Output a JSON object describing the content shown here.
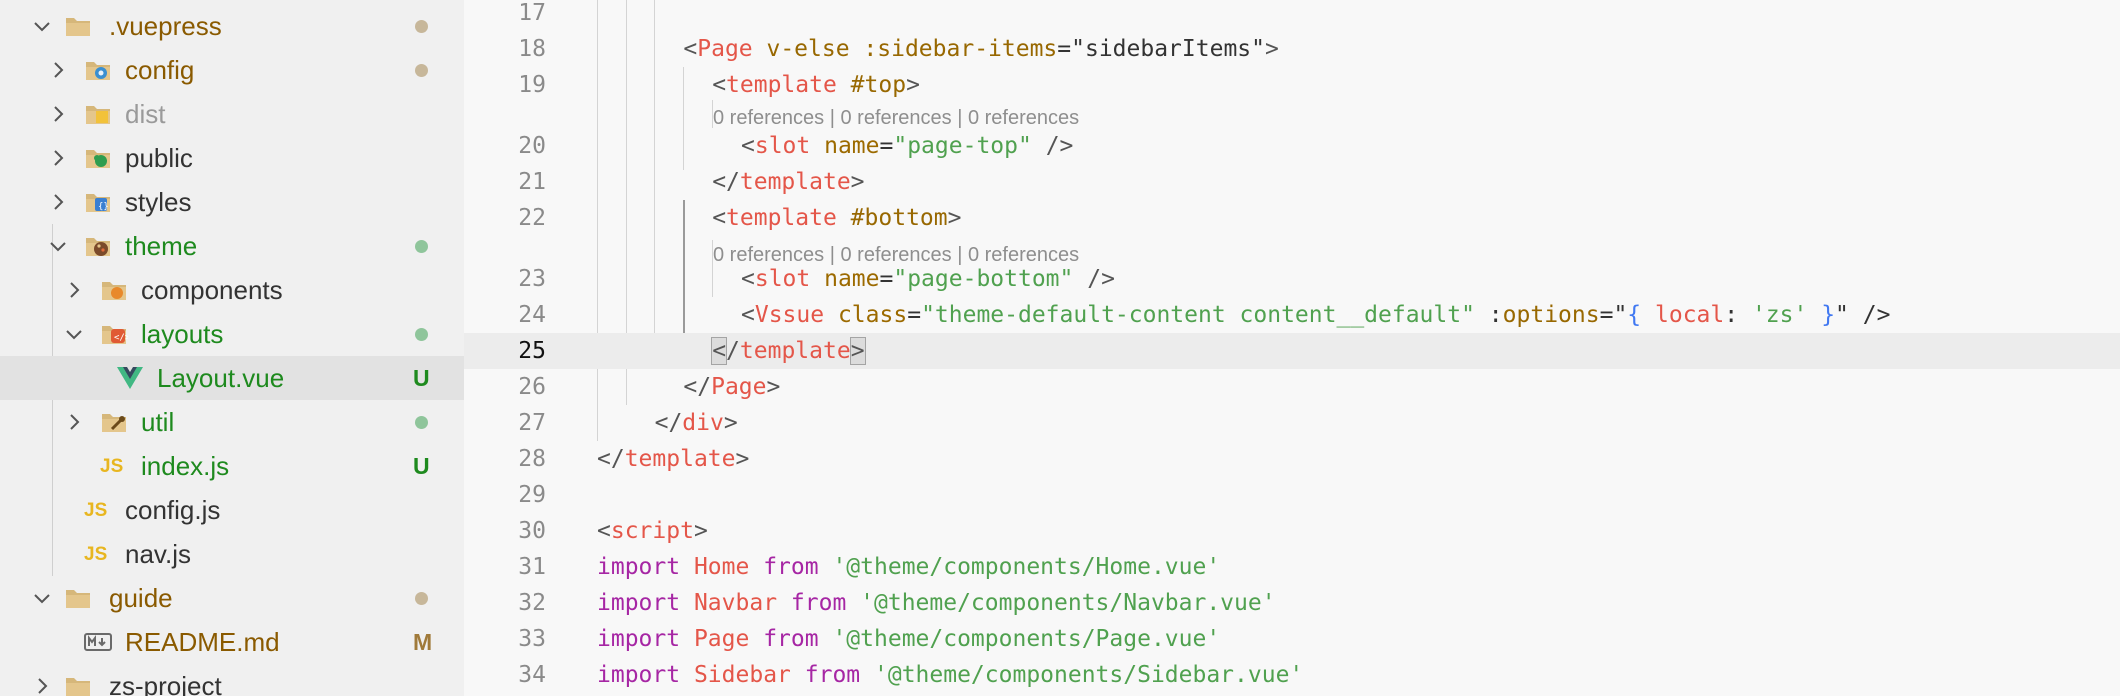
{
  "explorer": {
    "items": [
      {
        "id": "vuepress",
        "label": ".vuepress",
        "icon": "folder-icon",
        "expanded": true,
        "color": "#8a5a00",
        "status": "dot",
        "status_color": "#c7b79a"
      },
      {
        "id": "config",
        "label": "config",
        "icon": "folder-config-icon",
        "expanded": false,
        "color": "#8a5a00",
        "status": "dot",
        "status_color": "#c7b79a"
      },
      {
        "id": "dist",
        "label": "dist",
        "icon": "folder-dist-icon",
        "expanded": false,
        "color": "#9a9a9a",
        "status": "none"
      },
      {
        "id": "public",
        "label": "public",
        "icon": "folder-public-icon",
        "expanded": false,
        "color": "#333333",
        "status": "none"
      },
      {
        "id": "styles",
        "label": "styles",
        "icon": "folder-styles-icon",
        "expanded": false,
        "color": "#333333",
        "status": "none"
      },
      {
        "id": "theme",
        "label": "theme",
        "icon": "folder-theme-icon",
        "expanded": true,
        "color": "#1e8a1e",
        "status": "dot",
        "status_color": "#8fc59b"
      },
      {
        "id": "components",
        "label": "components",
        "icon": "folder-components-icon",
        "expanded": false,
        "color": "#333333",
        "status": "none"
      },
      {
        "id": "layouts",
        "label": "layouts",
        "icon": "folder-layouts-icon",
        "expanded": true,
        "color": "#1e8a1e",
        "status": "dot",
        "status_color": "#8fc59b"
      },
      {
        "id": "layout-vue",
        "label": "Layout.vue",
        "icon": "vue-file-icon",
        "color": "#1e8a1e",
        "status": "badge",
        "badge": "U",
        "badge_color": "#1e8a1e"
      },
      {
        "id": "util",
        "label": "util",
        "icon": "folder-util-icon",
        "expanded": false,
        "color": "#1e8a1e",
        "status": "dot",
        "status_color": "#8fc59b"
      },
      {
        "id": "index-js",
        "label": "index.js",
        "icon": "js-file-icon",
        "icon_text": "JS",
        "color": "#1e8a1e",
        "status": "badge",
        "badge": "U",
        "badge_color": "#1e8a1e"
      },
      {
        "id": "config-js",
        "label": "config.js",
        "icon": "js-file-icon",
        "icon_text": "JS",
        "color": "#333333",
        "status": "none"
      },
      {
        "id": "nav-js",
        "label": "nav.js",
        "icon": "js-file-icon",
        "icon_text": "JS",
        "color": "#333333",
        "status": "none"
      },
      {
        "id": "guide",
        "label": "guide",
        "icon": "folder-icon",
        "expanded": true,
        "color": "#8a5a00",
        "status": "dot",
        "status_color": "#c7b79a"
      },
      {
        "id": "readme",
        "label": "README.md",
        "icon": "markdown-file-icon",
        "color": "#8a5a00",
        "status": "badge",
        "badge": "M",
        "badge_color": "#a07a3a"
      },
      {
        "id": "zs-project",
        "label": "zs-project",
        "icon": "folder-icon",
        "expanded": false,
        "color": "#333333",
        "status": "none"
      }
    ]
  },
  "editor": {
    "current_line": "25",
    "codelens_text": "0 references | 0 references | 0 references",
    "lines": [
      {
        "n": "17",
        "tokens": []
      },
      {
        "n": "18",
        "tokens": [
          {
            "t": "<",
            "c": "br"
          },
          {
            "t": "Page",
            "c": "tag"
          },
          {
            "t": " v-else :",
            "c": "dir"
          },
          {
            "t": "sidebar-items",
            "c": "dir"
          },
          {
            "t": "=\"sidebarItems\"",
            "c": "plain"
          },
          {
            "t": ">",
            "c": "br"
          }
        ]
      },
      {
        "n": "19",
        "tokens": [
          {
            "t": "<",
            "c": "br"
          },
          {
            "t": "template",
            "c": "tag"
          },
          {
            "t": " #top",
            "c": "dir"
          },
          {
            "t": ">",
            "c": "br"
          }
        ]
      },
      {
        "n": "20",
        "tokens": [
          {
            "t": "<",
            "c": "br"
          },
          {
            "t": "slot",
            "c": "tag"
          },
          {
            "t": " name",
            "c": "attr"
          },
          {
            "t": "=",
            "c": "plain"
          },
          {
            "t": "\"page-top\"",
            "c": "str"
          },
          {
            "t": " />",
            "c": "br"
          }
        ]
      },
      {
        "n": "21",
        "tokens": [
          {
            "t": "</",
            "c": "br"
          },
          {
            "t": "template",
            "c": "tag"
          },
          {
            "t": ">",
            "c": "br"
          }
        ]
      },
      {
        "n": "22",
        "tokens": [
          {
            "t": "<",
            "c": "br"
          },
          {
            "t": "template",
            "c": "tag"
          },
          {
            "t": " #bottom",
            "c": "dir"
          },
          {
            "t": ">",
            "c": "br"
          }
        ]
      },
      {
        "n": "23",
        "tokens": [
          {
            "t": "<",
            "c": "br"
          },
          {
            "t": "slot",
            "c": "tag"
          },
          {
            "t": " name",
            "c": "attr"
          },
          {
            "t": "=",
            "c": "plain"
          },
          {
            "t": "\"page-bottom\"",
            "c": "str"
          },
          {
            "t": " />",
            "c": "br"
          }
        ]
      },
      {
        "n": "24",
        "tokens": [
          {
            "t": "<",
            "c": "br"
          },
          {
            "t": "Vssue",
            "c": "tag"
          },
          {
            "t": " class",
            "c": "attr"
          },
          {
            "t": "=",
            "c": "plain"
          },
          {
            "t": "\"theme-default-content content__default\"",
            "c": "str"
          },
          {
            "t": " :",
            "c": "plain"
          },
          {
            "t": "options",
            "c": "dir"
          },
          {
            "t": "=\"",
            "c": "plain"
          },
          {
            "t": "{",
            "c": "blue"
          },
          {
            "t": " local",
            "c": "tag"
          },
          {
            "t": ": ",
            "c": "plain"
          },
          {
            "t": "'zs'",
            "c": "str"
          },
          {
            "t": " }",
            "c": "blue"
          },
          {
            "t": "\" />",
            "c": "plain"
          }
        ]
      },
      {
        "n": "25",
        "tokens": [
          {
            "t": "<",
            "c": "br",
            "bm": true
          },
          {
            "t": "/",
            "c": "br"
          },
          {
            "t": "template",
            "c": "tag"
          },
          {
            "t": ">",
            "c": "br",
            "bm": true
          }
        ]
      },
      {
        "n": "26",
        "tokens": [
          {
            "t": "</",
            "c": "br"
          },
          {
            "t": "Page",
            "c": "tag"
          },
          {
            "t": ">",
            "c": "br"
          }
        ]
      },
      {
        "n": "27",
        "tokens": [
          {
            "t": "</",
            "c": "br"
          },
          {
            "t": "div",
            "c": "tag"
          },
          {
            "t": ">",
            "c": "br"
          }
        ]
      },
      {
        "n": "28",
        "tokens": [
          {
            "t": "</",
            "c": "br"
          },
          {
            "t": "template",
            "c": "tag"
          },
          {
            "t": ">",
            "c": "br"
          }
        ]
      },
      {
        "n": "29",
        "tokens": []
      },
      {
        "n": "30",
        "tokens": [
          {
            "t": "<",
            "c": "br"
          },
          {
            "t": "script",
            "c": "tag"
          },
          {
            "t": ">",
            "c": "br"
          }
        ]
      },
      {
        "n": "31",
        "tokens": [
          {
            "t": "import",
            "c": "kw"
          },
          {
            "t": " ",
            "c": "plain"
          },
          {
            "t": "Home",
            "c": "tag"
          },
          {
            "t": " ",
            "c": "plain"
          },
          {
            "t": "from",
            "c": "kw"
          },
          {
            "t": " ",
            "c": "plain"
          },
          {
            "t": "'@theme/components/Home.vue'",
            "c": "str"
          }
        ]
      },
      {
        "n": "32",
        "tokens": [
          {
            "t": "import",
            "c": "kw"
          },
          {
            "t": " ",
            "c": "plain"
          },
          {
            "t": "Navbar",
            "c": "tag"
          },
          {
            "t": " ",
            "c": "plain"
          },
          {
            "t": "from",
            "c": "kw"
          },
          {
            "t": " ",
            "c": "plain"
          },
          {
            "t": "'@theme/components/Navbar.vue'",
            "c": "str"
          }
        ]
      },
      {
        "n": "33",
        "tokens": [
          {
            "t": "import",
            "c": "kw"
          },
          {
            "t": " ",
            "c": "plain"
          },
          {
            "t": "Page",
            "c": "tag"
          },
          {
            "t": " ",
            "c": "plain"
          },
          {
            "t": "from",
            "c": "kw"
          },
          {
            "t": " ",
            "c": "plain"
          },
          {
            "t": "'@theme/components/Page.vue'",
            "c": "str"
          }
        ]
      },
      {
        "n": "34",
        "tokens": [
          {
            "t": "import",
            "c": "kw"
          },
          {
            "t": " ",
            "c": "plain"
          },
          {
            "t": "Sidebar",
            "c": "tag"
          },
          {
            "t": " ",
            "c": "plain"
          },
          {
            "t": "from",
            "c": "kw"
          },
          {
            "t": " ",
            "c": "plain"
          },
          {
            "t": "'@theme/components/Sidebar.vue'",
            "c": "str"
          }
        ]
      }
    ]
  }
}
